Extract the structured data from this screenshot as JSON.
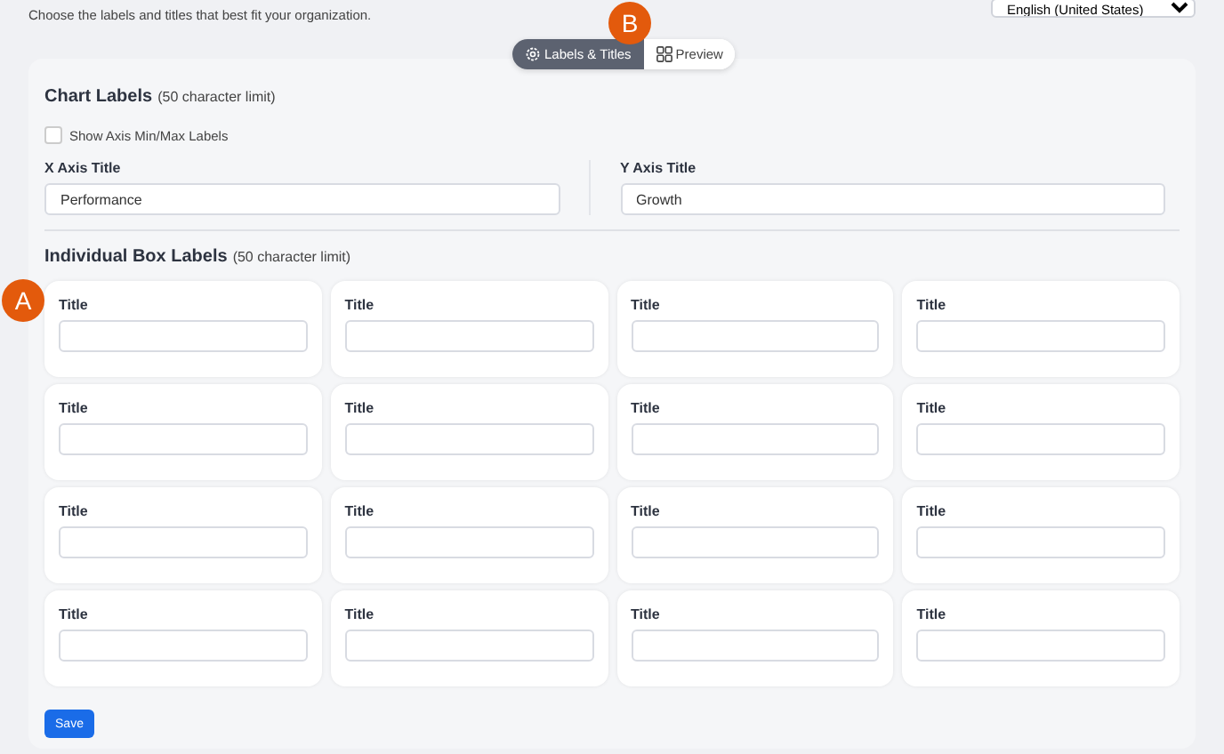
{
  "description": "Choose the labels and titles that best fit your organization.",
  "language_select": {
    "value": "English (United States)"
  },
  "view_toggle": [
    {
      "label": "Labels & Titles",
      "selected": true
    },
    {
      "label": "Preview",
      "selected": false
    }
  ],
  "callouts": [
    {
      "letter": "B"
    },
    {
      "letter": "A"
    }
  ],
  "chart_labels": {
    "title": "Chart Labels",
    "note": "(50 character limit)",
    "show_min_max": {
      "label": "Show Axis Min/Max Labels",
      "checked": false
    },
    "fields": [
      {
        "label": "X Axis Title",
        "value": "Performance"
      },
      {
        "label": "Y Axis Title",
        "value": "Growth"
      }
    ]
  },
  "box_labels": {
    "title": "Individual Box Labels",
    "note": "(50 character limit)",
    "boxes": [
      {
        "label": "Title"
      },
      {
        "label": "Title"
      },
      {
        "label": "Title"
      },
      {
        "label": "Title"
      },
      {
        "label": "Title"
      },
      {
        "label": "Title"
      },
      {
        "label": "Title"
      },
      {
        "label": "Title"
      },
      {
        "label": "Title"
      },
      {
        "label": "Title"
      },
      {
        "label": "Title"
      },
      {
        "label": "Title"
      },
      {
        "label": "Title"
      },
      {
        "label": "Title"
      },
      {
        "label": "Title"
      },
      {
        "label": "Title"
      }
    ]
  },
  "save_button": "Save"
}
